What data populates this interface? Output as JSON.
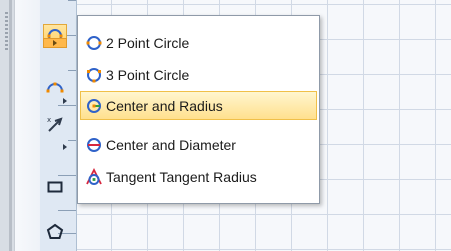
{
  "toolbar": {
    "tools": [
      {
        "name": "circle-tool",
        "icon": "circle-icon",
        "active": true
      },
      {
        "name": "arc-tool",
        "icon": "arc-icon",
        "active": false
      },
      {
        "name": "dimension-tool",
        "icon": "dimension-icon",
        "active": false
      },
      {
        "name": "rectangle-tool",
        "icon": "rectangle-icon",
        "active": false
      },
      {
        "name": "polygon-tool",
        "icon": "polygon-icon",
        "active": false
      }
    ]
  },
  "circle_menu": {
    "items": [
      {
        "label": "2 Point Circle",
        "icon": "two-point-circle-icon",
        "hovered": false
      },
      {
        "label": "3 Point Circle",
        "icon": "three-point-circle-icon",
        "hovered": false
      },
      {
        "label": "Center and Radius",
        "icon": "center-radius-circle-icon",
        "hovered": true
      },
      {
        "label": "Center and Diameter",
        "icon": "center-diameter-circle-icon",
        "hovered": false
      },
      {
        "label": "Tangent Tangent Radius",
        "icon": "tangent-radius-circle-icon",
        "hovered": false
      }
    ]
  },
  "colors": {
    "icon_blue": "#2f62c9",
    "icon_orange": "#f08a00",
    "hover_yellow": "#ffe08e",
    "icon_green": "#2f9e44",
    "icon_red": "#d7263d"
  }
}
